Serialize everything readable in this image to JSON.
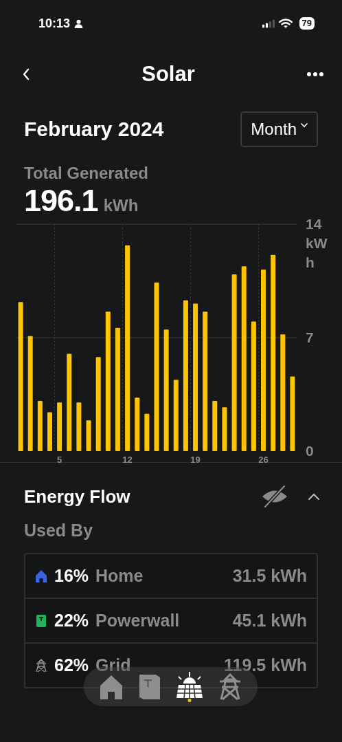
{
  "status_bar": {
    "time": "10:13",
    "battery": "79"
  },
  "header": {
    "title": "Solar"
  },
  "period": {
    "label": "February 2024",
    "dropdown": "Month"
  },
  "summary": {
    "label": "Total Generated",
    "value": "196.1",
    "unit": "kWh"
  },
  "chart_data": {
    "type": "bar",
    "x": [
      1,
      2,
      3,
      4,
      5,
      6,
      7,
      8,
      9,
      10,
      11,
      12,
      13,
      14,
      15,
      16,
      17,
      18,
      19,
      20,
      21,
      22,
      23,
      24,
      25,
      26,
      27,
      28,
      29
    ],
    "series": [
      {
        "color": "#ffc400",
        "values": [
          9.2,
          7.1,
          3.1,
          2.4,
          3.0,
          6.0,
          3.0,
          1.9,
          5.8,
          8.6,
          7.6,
          12.7,
          3.3,
          2.3,
          10.4,
          7.5,
          4.4,
          9.3,
          9.1,
          8.6,
          3.1,
          2.7,
          10.9,
          11.4,
          8.0,
          11.2,
          12.1,
          7.2,
          4.6
        ]
      }
    ],
    "ylabel": "kWh",
    "xlim": [
      0.5,
      29.5
    ],
    "ylim": [
      0,
      14
    ],
    "yticks": [
      0,
      7,
      14
    ],
    "xticks": [
      5,
      12,
      19,
      26
    ]
  },
  "energy_flow": {
    "title": "Energy Flow",
    "subtitle": "Used By",
    "hidden": true,
    "expanded": true,
    "rows": [
      {
        "kind": "home",
        "color": "#3b63e0",
        "percent": "16%",
        "label": "Home",
        "value": "31.5 kWh"
      },
      {
        "kind": "powerwall",
        "color": "#1fb35a",
        "percent": "22%",
        "label": "Powerwall",
        "value": "45.1 kWh"
      },
      {
        "kind": "grid",
        "color": "#8a8a8a",
        "percent": "62%",
        "label": "Grid",
        "value": "119.5 kWh"
      }
    ]
  },
  "tab_bar": [
    {
      "kind": "home",
      "selected": false
    },
    {
      "kind": "powerwall",
      "selected": false
    },
    {
      "kind": "solar",
      "selected": true
    },
    {
      "kind": "grid",
      "selected": false
    }
  ]
}
